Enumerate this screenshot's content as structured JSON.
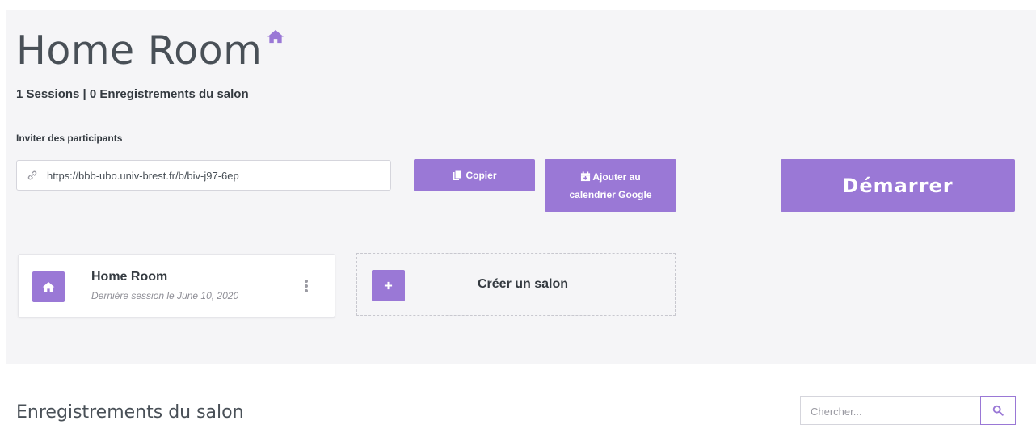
{
  "header": {
    "title": "Home Room",
    "subtitle": "1 Sessions | 0 Enregistrements du salon"
  },
  "invite": {
    "label": "Inviter des participants",
    "url": "https://bbb-ubo.univ-brest.fr/b/biv-j97-6ep"
  },
  "actions": {
    "copy_label": "Copier",
    "calendar_line1": "Ajouter au",
    "calendar_line2": "calendrier Google",
    "start_label": "Démarrer"
  },
  "rooms": {
    "current": {
      "name": "Home Room",
      "last_session": "Dernière session le June 10, 2020"
    },
    "create_label": "Créer un salon"
  },
  "recordings": {
    "title": "Enregistrements du salon",
    "search_placeholder": "Chercher..."
  },
  "colors": {
    "accent": "#9a78d6",
    "panel_background": "#f5f5f7"
  },
  "icons": [
    "home-icon",
    "link-icon",
    "copy-icon",
    "calendar-plus-icon",
    "kebab-menu-icon",
    "plus-icon",
    "search-icon"
  ]
}
